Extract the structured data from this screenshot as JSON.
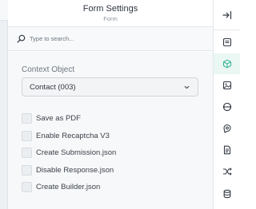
{
  "header": {
    "title": "Form Settings",
    "subtitle": "Form"
  },
  "search": {
    "placeholder": "Type to search..."
  },
  "context": {
    "label": "Context Object",
    "selected": "Contact (003)"
  },
  "options": [
    {
      "label": "Save as PDF",
      "checked": false
    },
    {
      "label": "Enable Recaptcha V3",
      "checked": false
    },
    {
      "label": "Create Submission.json",
      "checked": false
    },
    {
      "label": "Disable Response.json",
      "checked": false
    },
    {
      "label": "Create Builder.json",
      "checked": false
    }
  ],
  "toolbar": {
    "collapse_icon": "collapse-right-icon",
    "items": [
      {
        "icon": "list-icon",
        "active": false
      },
      {
        "icon": "cube-icon",
        "active": true
      },
      {
        "icon": "image-icon",
        "active": false
      },
      {
        "icon": "link-icon",
        "active": false
      },
      {
        "icon": "location-icon",
        "active": false
      },
      {
        "icon": "document-icon",
        "active": false
      },
      {
        "icon": "shuffle-icon",
        "active": false
      },
      {
        "icon": "database-icon",
        "active": false
      }
    ]
  },
  "colors": {
    "accent": "#3fb39a",
    "active_bg": "#eaf7f3"
  }
}
